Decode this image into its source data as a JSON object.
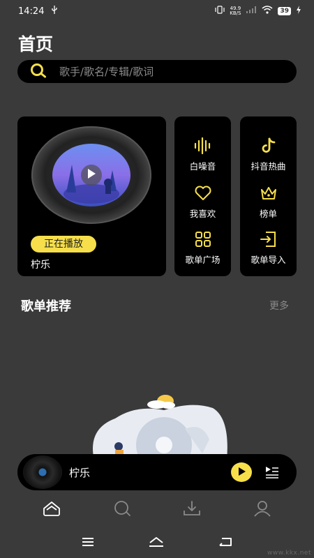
{
  "status_bar": {
    "time": "14:24",
    "net_speed_value": "49.9",
    "net_speed_unit": "KB/S",
    "battery": "39"
  },
  "page_title": "首页",
  "search": {
    "placeholder": "歌手/歌名/专辑/歌词"
  },
  "now_playing_card": {
    "badge": "正在播放",
    "title": "柠乐"
  },
  "quick_grid": {
    "col1": [
      {
        "label": "白噪音",
        "icon": "waveform-icon"
      },
      {
        "label": "我喜欢",
        "icon": "heart-icon"
      },
      {
        "label": "歌单广场",
        "icon": "grid-icon"
      }
    ],
    "col2": [
      {
        "label": "抖音热曲",
        "icon": "tiktok-icon"
      },
      {
        "label": "榜单",
        "icon": "crown-icon"
      },
      {
        "label": "歌单导入",
        "icon": "import-icon"
      }
    ]
  },
  "recommend": {
    "title": "歌单推荐",
    "more": "更多"
  },
  "mini_player": {
    "title": "柠乐"
  },
  "bottom_nav": [
    "home-icon",
    "search-icon",
    "download-icon",
    "profile-icon"
  ],
  "colors": {
    "accent": "#f6df4a",
    "background": "#3a3a3a",
    "card": "#000000"
  },
  "watermark": "www.kkx.net"
}
